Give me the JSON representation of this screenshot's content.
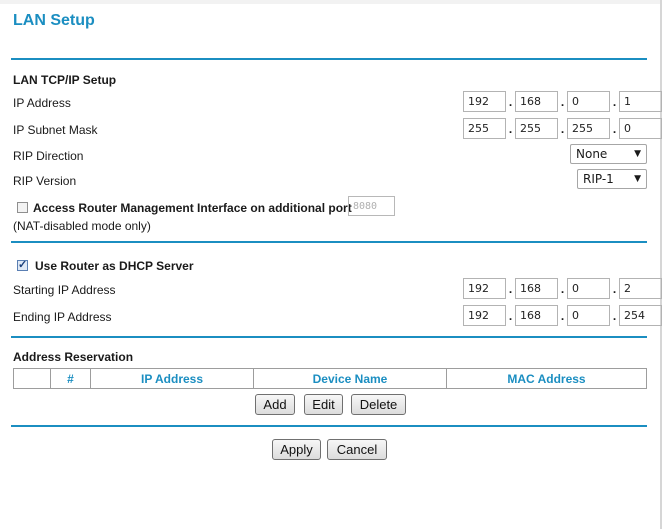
{
  "page": {
    "title": "LAN Setup"
  },
  "lan": {
    "section_label": "LAN TCP/IP Setup",
    "ip_label": "IP Address",
    "ip": [
      "192",
      "168",
      "0",
      "1"
    ],
    "mask_label": "IP Subnet Mask",
    "mask": [
      "255",
      "255",
      "255",
      "0"
    ],
    "rip_direction_label": "RIP Direction",
    "rip_direction_value": "None",
    "rip_version_label": "RIP Version",
    "rip_version_value": "RIP-1",
    "mgmt_label": "Access Router Management Interface on additional port",
    "mgmt_checked": false,
    "mgmt_port": "8080",
    "mgmt_note": "(NAT-disabled mode only)"
  },
  "dhcp": {
    "checkbox_label": "Use Router as DHCP Server",
    "checked": true,
    "start_label": "Starting IP Address",
    "start": [
      "192",
      "168",
      "0",
      "2"
    ],
    "end_label": "Ending IP Address",
    "end": [
      "192",
      "168",
      "0",
      "254"
    ]
  },
  "reservation": {
    "section_label": "Address Reservation",
    "columns": [
      "",
      "#",
      "IP Address",
      "Device Name",
      "MAC Address"
    ],
    "add_label": "Add",
    "edit_label": "Edit",
    "delete_label": "Delete"
  },
  "actions": {
    "apply_label": "Apply",
    "cancel_label": "Cancel"
  },
  "colors": {
    "accent": "#1b8ec1"
  }
}
